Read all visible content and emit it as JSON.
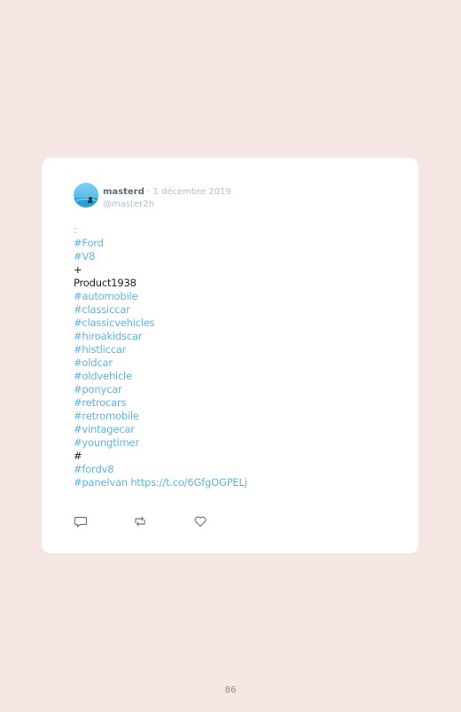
{
  "tweet": {
    "author_name": "masterd",
    "separator": " · ",
    "date": "1 décembre 2019",
    "handle": "@master2h",
    "lines": [
      {
        "text": ":",
        "style": "tag"
      },
      {
        "text": "#Ford",
        "style": "tag"
      },
      {
        "text": "#V8",
        "style": "tag"
      },
      {
        "text": "+",
        "style": "plain"
      },
      {
        "text": "Product1938",
        "style": "plain"
      },
      {
        "text": "#automobile",
        "style": "tag"
      },
      {
        "text": "#classiccar",
        "style": "tag"
      },
      {
        "text": "#classicvehicles",
        "style": "tag"
      },
      {
        "text": "#hiroakidscar",
        "style": "tag"
      },
      {
        "text": "#histliccar",
        "style": "tag"
      },
      {
        "text": "#oldcar",
        "style": "tag"
      },
      {
        "text": "#oldvehicle",
        "style": "tag"
      },
      {
        "text": "#ponycar",
        "style": "tag"
      },
      {
        "text": "#retrocars",
        "style": "tag"
      },
      {
        "text": "#retromobile",
        "style": "tag"
      },
      {
        "text": "#vintagecar",
        "style": "tag"
      },
      {
        "text": "#youngtimer",
        "style": "tag"
      },
      {
        "text": "#",
        "style": "plain"
      },
      {
        "text": "#fordv8",
        "style": "tag"
      },
      {
        "text": "#panelvan https://t.co/6GfgOGPELj",
        "style": "tag"
      }
    ],
    "actions": [
      {
        "name": "reply-icon"
      },
      {
        "name": "retweet-icon"
      },
      {
        "name": "like-icon"
      }
    ]
  },
  "page_number": "86",
  "colors": {
    "background": "#f5e6e3",
    "card": "#ffffff",
    "hashtag": "#5fb5e6",
    "text": "#222222",
    "muted": "#b5bec6",
    "icon": "#6b7a87"
  }
}
